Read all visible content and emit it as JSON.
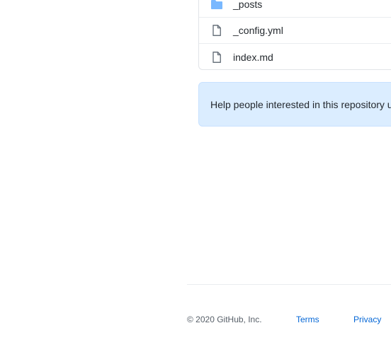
{
  "files": [
    {
      "name": "_posts",
      "type": "folder",
      "icon": "folder-icon"
    },
    {
      "name": "_config.yml",
      "type": "file",
      "icon": "file-icon"
    },
    {
      "name": "index.md",
      "type": "file",
      "icon": "file-icon"
    }
  ],
  "banner": {
    "text": "Help people interested in this repository u"
  },
  "footer": {
    "copyright": "© 2020 GitHub, Inc.",
    "links": [
      "Terms",
      "Privacy"
    ]
  },
  "colors": {
    "folder": "#79b8ff",
    "file_icon": "#6a737d",
    "link": "#0366d6",
    "banner_bg": "#dbedff",
    "banner_border": "#c8e1ff"
  }
}
